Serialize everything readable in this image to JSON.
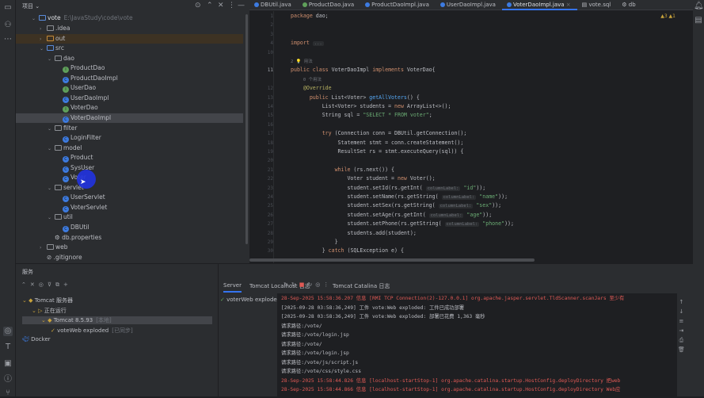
{
  "project_panel": {
    "title": "项目",
    "root": {
      "name": "vote",
      "path": "E:\\JavaStudy\\code\\vote"
    },
    "items": [
      {
        "label": ".idea",
        "kind": "folder",
        "depth": 1,
        "expanded": false
      },
      {
        "label": "out",
        "kind": "folder-excluded",
        "depth": 1,
        "expanded": false
      },
      {
        "label": "src",
        "kind": "folder-src",
        "depth": 1,
        "expanded": true
      },
      {
        "label": "dao",
        "kind": "package",
        "depth": 2,
        "expanded": true
      },
      {
        "label": "ProductDao",
        "kind": "interface",
        "depth": 3
      },
      {
        "label": "ProductDaoImpl",
        "kind": "class",
        "depth": 3
      },
      {
        "label": "UserDao",
        "kind": "interface",
        "depth": 3
      },
      {
        "label": "UserDaoImpl",
        "kind": "class",
        "depth": 3
      },
      {
        "label": "VoterDao",
        "kind": "interface",
        "depth": 3
      },
      {
        "label": "VoterDaoImpl",
        "kind": "class",
        "depth": 3,
        "selected": true
      },
      {
        "label": "filter",
        "kind": "package",
        "depth": 2,
        "expanded": true
      },
      {
        "label": "LoginFilter",
        "kind": "class",
        "depth": 3
      },
      {
        "label": "model",
        "kind": "package",
        "depth": 2,
        "expanded": true
      },
      {
        "label": "Product",
        "kind": "class",
        "depth": 3
      },
      {
        "label": "SysUser",
        "kind": "class",
        "depth": 3
      },
      {
        "label": "Voter",
        "kind": "class",
        "depth": 3
      },
      {
        "label": "servlet",
        "kind": "package",
        "depth": 2,
        "expanded": true
      },
      {
        "label": "UserServlet",
        "kind": "class",
        "depth": 3
      },
      {
        "label": "VoterServlet",
        "kind": "class",
        "depth": 3
      },
      {
        "label": "util",
        "kind": "package",
        "depth": 2,
        "expanded": true
      },
      {
        "label": "DBUtil",
        "kind": "class",
        "depth": 3
      },
      {
        "label": "db.properties",
        "kind": "properties",
        "depth": 2
      },
      {
        "label": "web",
        "kind": "folder",
        "depth": 1,
        "expanded": false
      },
      {
        "label": ".gitignore",
        "kind": "gitignore",
        "depth": 1
      }
    ]
  },
  "editor": {
    "tabs": [
      {
        "label": "DBUtil.java",
        "kind": "class"
      },
      {
        "label": "ProductDao.java",
        "kind": "interface"
      },
      {
        "label": "ProductDaoImpl.java",
        "kind": "class"
      },
      {
        "label": "UserDaoImpl.java",
        "kind": "class"
      },
      {
        "label": "VoterDaoImpl.java",
        "kind": "class",
        "active": true
      },
      {
        "label": "vote.sql",
        "kind": "sql"
      },
      {
        "label": "db",
        "kind": "db"
      }
    ],
    "inspections": "▲3 ▲1",
    "lines": [
      {
        "n": "1",
        "html": "<span class=kw>package</span> dao;"
      },
      {
        "n": "2",
        "html": ""
      },
      {
        "n": "3",
        "html": ""
      },
      {
        "n": "4",
        "html": "<span class=kw>import</span> <span class=hint>...</span>"
      },
      {
        "n": "10",
        "html": ""
      },
      {
        "n": "",
        "html": "<span class=cm>2 💡 用法</span>"
      },
      {
        "n": "11",
        "html": "<span class=kw>public class</span> VoterDaoImpl <span class=kw>implements</span> VoterDao{"
      },
      {
        "n": "",
        "html": "    <span class=cm>0 个用法</span>"
      },
      {
        "n": "12",
        "html": "    <span class=an>@Override</span>"
      },
      {
        "n": "13",
        "html": "      <span class=kw>public</span> List&lt;Voter&gt; <span class=fn>getAllVoters</span>() {"
      },
      {
        "n": "14",
        "html": "          List&lt;Voter&gt; students = <span class=kw>new</span> ArrayList&lt;&gt;();"
      },
      {
        "n": "15",
        "html": "          String sql = <span class=st>\"SELECT * FROM voter\"</span>;"
      },
      {
        "n": "16",
        "html": ""
      },
      {
        "n": "17",
        "html": "          <span class=kw>try</span> (Connection conn = DBUtil.getConnection();"
      },
      {
        "n": "18",
        "html": "               Statement stmt = conn.createStatement();"
      },
      {
        "n": "19",
        "html": "               ResultSet rs = stmt.executeQuery(sql)) {"
      },
      {
        "n": "20",
        "html": ""
      },
      {
        "n": "21",
        "html": "              <span class=kw>while</span> (rs.next()) {"
      },
      {
        "n": "22",
        "html": "                  Voter student = <span class=kw>new</span> Voter();"
      },
      {
        "n": "23",
        "html": "                  student.setId(rs.getInt( <span class=hint>columnLabel:</span> <span class=st>\"id\"</span>));"
      },
      {
        "n": "24",
        "html": "                  student.setName(rs.getString( <span class=hint>columnLabel:</span> <span class=st>\"name\"</span>));"
      },
      {
        "n": "25",
        "html": "                  student.setSex(rs.getString( <span class=hint>columnLabel:</span> <span class=st>\"sex\"</span>));"
      },
      {
        "n": "26",
        "html": "                  student.setAge(rs.getInt( <span class=hint>columnLabel:</span> <span class=st>\"age\"</span>));"
      },
      {
        "n": "27",
        "html": "                  student.setPhone(rs.getString( <span class=hint>columnLabel:</span> <span class=st>\"phone\"</span>));"
      },
      {
        "n": "28",
        "html": "                  students.add(student);"
      },
      {
        "n": "29",
        "html": "              }"
      },
      {
        "n": "30",
        "html": "          } <span class=kw>catch</span> (SQLException e) {"
      }
    ]
  },
  "services": {
    "title": "服务",
    "tree": [
      {
        "label": "Tomcat 服务器",
        "depth": 0
      },
      {
        "label": "正在运行",
        "depth": 1
      },
      {
        "label": "Tomcat 8.5.93",
        "suffix": "[本地]",
        "depth": 2,
        "selected": true
      },
      {
        "label": "voteWeb exploded",
        "suffix": "[已同步]",
        "depth": 3
      },
      {
        "label": "Docker",
        "depth": 0
      }
    ],
    "tabs": [
      {
        "label": "Server",
        "active": true
      },
      {
        "label": "Tomcat Localhost 日志"
      },
      {
        "label": "Tomcat Catalina 日志"
      }
    ],
    "deployment": "voterWeb exploded",
    "console": [
      {
        "text": "28-Sep-2025 15:58:36.207 信息 [RMI TCP Connection(2)-127.0.0.1] org.apache.jasper.servlet.TldScanner.scanJars 至少有",
        "level": "info-red"
      },
      {
        "text": "[2025-09-28 03:58:36,249] 工件 vote:Web exploded: 工件已成功部署",
        "level": "normal"
      },
      {
        "text": "[2025-09-28 03:58:36,249] 工件 vote:Web exploded: 部署已花费 1,363 毫秒",
        "level": "normal"
      },
      {
        "text": "请求路径:/vote/",
        "level": "normal"
      },
      {
        "text": "请求路径:/vote/login.jsp",
        "level": "normal"
      },
      {
        "text": "请求路径:/vote/",
        "level": "normal"
      },
      {
        "text": "请求路径:/vote/login.jsp",
        "level": "normal"
      },
      {
        "text": "请求路径:/vote/js/script.js",
        "level": "normal"
      },
      {
        "text": "请求路径:/vote/css/style.css",
        "level": "normal"
      },
      {
        "text": "28-Sep-2025 15:58:44.826 信息 [localhost-startStop-1] org.apache.catalina.startup.HostConfig.deployDirectory 把web",
        "level": "info-red"
      },
      {
        "text": "28-Sep-2025 15:58:44.866 信息 [localhost-startStop-1] org.apache.catalina.startup.HostConfig.deployDirectory Web应",
        "level": "info-red"
      }
    ]
  }
}
